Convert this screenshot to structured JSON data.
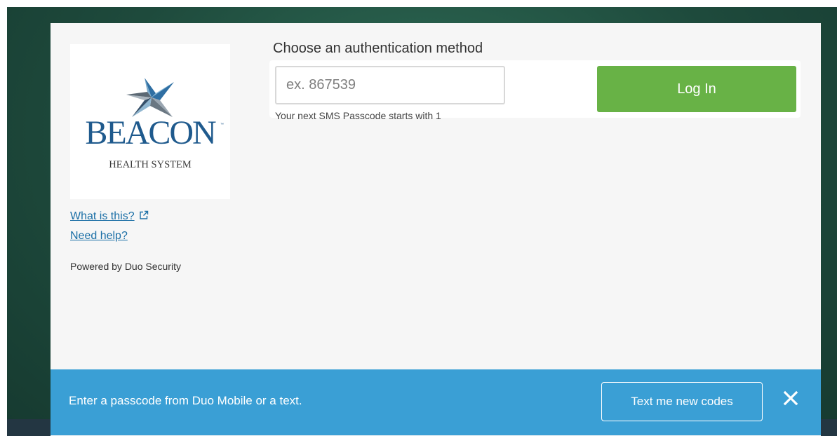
{
  "logo": {
    "wordmark": "BEACON",
    "trademark": "™",
    "subtitle": "HEALTH SYSTEM"
  },
  "links": {
    "what_is_this": "What is this?",
    "need_help": "Need help?"
  },
  "powered_by": "Powered by Duo Security",
  "auth": {
    "title": "Choose an authentication method",
    "passcode_placeholder": "ex. 867539",
    "passcode_value": "",
    "login_label": "Log In",
    "hint": "Your next SMS Passcode starts with 1"
  },
  "footer": {
    "message": "Enter a passcode from Duo Mobile or a text.",
    "text_me_label": "Text me new codes",
    "close_icon": "close-icon"
  },
  "colors": {
    "login_green": "#68b246",
    "footer_blue": "#3a9fd5",
    "link_blue": "#1b6fa6",
    "brand_blue": "#1f5a8d"
  }
}
